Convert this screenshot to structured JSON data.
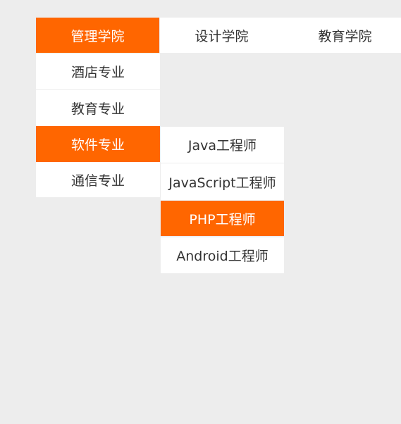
{
  "top_menu": {
    "items": [
      {
        "label": "管理学院",
        "active": true
      },
      {
        "label": "设计学院",
        "active": false
      },
      {
        "label": "教育学院",
        "active": false
      }
    ]
  },
  "sub_menu": {
    "items": [
      {
        "label": "酒店专业",
        "active": false
      },
      {
        "label": "教育专业",
        "active": false
      },
      {
        "label": "软件专业",
        "active": true
      },
      {
        "label": "通信专业",
        "active": false
      }
    ]
  },
  "third_menu": {
    "items": [
      {
        "label": "Java工程师",
        "active": false
      },
      {
        "label": "JavaScript工程师",
        "active": false
      },
      {
        "label": "PHP工程师",
        "active": true
      },
      {
        "label": "Android工程师",
        "active": false
      }
    ]
  },
  "colors": {
    "accent": "#ff6600",
    "background": "#ededed",
    "item_background": "#ffffff",
    "text": "#333333",
    "active_text": "#ffffff"
  }
}
